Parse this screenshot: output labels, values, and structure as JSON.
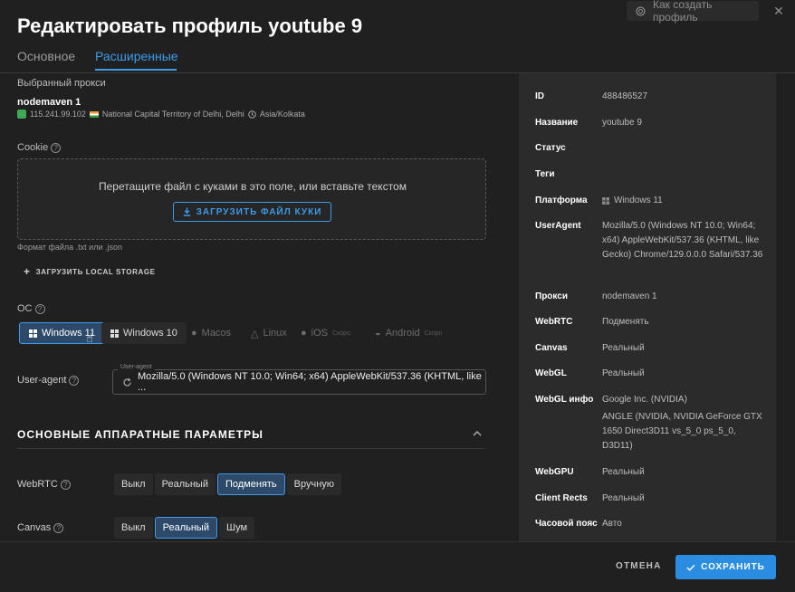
{
  "dialog": {
    "title": "Редактировать профиль youtube 9",
    "help_link": "Как создать профиль"
  },
  "tabs": [
    {
      "label": "Основное",
      "active": false
    },
    {
      "label": "Расширенные",
      "active": true
    }
  ],
  "proxy": {
    "section_label": "Выбранный прокси",
    "name": "nodemaven 1",
    "ip": "115.241.99.102",
    "location": "National Capital Territory of Delhi, Delhi",
    "timezone": "Asia/Kolkata"
  },
  "cookie": {
    "label": "Cookie",
    "drop_text": "Перетащите файл с куками в это поле, или вставьте текстом",
    "upload_button": "ЗАГРУЗИТЬ ФАЙЛ КУКИ",
    "format_hint": "Формат файла .txt или .json",
    "local_storage_button": "ЗАГРУЗИТЬ LOCAL STORAGE"
  },
  "os": {
    "label": "ОС",
    "options": [
      {
        "label": "Windows 11",
        "active": true,
        "tag": ""
      },
      {
        "label": "Windows 10",
        "active": false,
        "tag": ""
      },
      {
        "label": "Macos",
        "active": false,
        "tag": ""
      },
      {
        "label": "Linux",
        "active": false,
        "tag": ""
      },
      {
        "label": "iOS",
        "active": false,
        "tag": "Скоро"
      },
      {
        "label": "Android",
        "active": false,
        "tag": "Скоро"
      }
    ]
  },
  "user_agent": {
    "label": "User-agent",
    "legend": "User-agent",
    "value": "Mozilla/5.0 (Windows NT 10.0; Win64; x64) AppleWebKit/537.36 (KHTML, like ..."
  },
  "hardware": {
    "title": "ОСНОВНЫЕ АППАРАТНЫЕ ПАРАМЕТРЫ",
    "webrtc": {
      "label": "WebRTC",
      "options": [
        "Выкл",
        "Реальный",
        "Подменять",
        "Вручную"
      ],
      "active": "Подменять"
    },
    "canvas": {
      "label": "Canvas",
      "options": [
        "Выкл",
        "Реальный",
        "Шум"
      ],
      "active": "Реальный"
    }
  },
  "summary": [
    {
      "key": "ID",
      "value": "488486527"
    },
    {
      "key": "Название",
      "value": "youtube 9"
    },
    {
      "key": "Статус",
      "value": ""
    },
    {
      "key": "Теги",
      "value": ""
    },
    {
      "key": "Платформа",
      "value": "Windows 11"
    },
    {
      "key": "UserAgent",
      "value": "Mozilla/5.0 (Windows NT 10.0; Win64; x64) AppleWebKit/537.36 (KHTML, like Gecko) Chrome/129.0.0.0 Safari/537.36"
    },
    {
      "key": "Прокси",
      "value": "nodemaven 1"
    },
    {
      "key": "WebRTC",
      "value": "Подменять"
    },
    {
      "key": "Canvas",
      "value": "Реальный"
    },
    {
      "key": "WebGL",
      "value": "Реальный"
    },
    {
      "key": "WebGL инфо",
      "value": "Google Inc. (NVIDIA)",
      "value2": "ANGLE (NVIDIA, NVIDIA GeForce GTX 1650 Direct3D11 vs_5_0 ps_5_0, D3D11)"
    },
    {
      "key": "WebGPU",
      "value": "Реальный"
    },
    {
      "key": "Client Rects",
      "value": "Реальный"
    },
    {
      "key": "Часовой пояс",
      "value": "Авто"
    }
  ],
  "footer": {
    "cancel": "ОТМЕНА",
    "save": "СОХРАНИТЬ"
  },
  "colors": {
    "accent": "#3d9be9",
    "save_bg": "#2a8de0",
    "panel_bg": "#2b2b2b",
    "page_bg": "#202020",
    "active_bg": "#2d4a6b"
  }
}
